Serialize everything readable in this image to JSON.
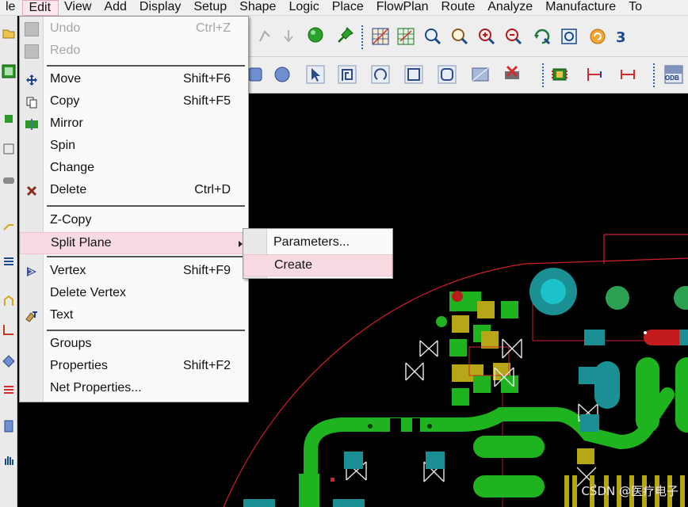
{
  "menubar": {
    "items": [
      "le",
      "Edit",
      "View",
      "Add",
      "Display",
      "Setup",
      "Shape",
      "Logic",
      "Place",
      "FlowPlan",
      "Route",
      "Analyze",
      "Manufacture",
      "To"
    ]
  },
  "edit_menu": {
    "undo": {
      "label": "Undo",
      "shortcut": "Ctrl+Z"
    },
    "redo": {
      "label": "Redo"
    },
    "move": {
      "label": "Move",
      "shortcut": "Shift+F6"
    },
    "copy": {
      "label": "Copy",
      "shortcut": "Shift+F5"
    },
    "mirror": {
      "label": "Mirror"
    },
    "spin": {
      "label": "Spin"
    },
    "change": {
      "label": "Change"
    },
    "delete": {
      "label": "Delete",
      "shortcut": "Ctrl+D"
    },
    "z_copy": {
      "label": "Z-Copy"
    },
    "split_plane": {
      "label": "Split Plane"
    },
    "vertex": {
      "label": "Vertex",
      "shortcut": "Shift+F9"
    },
    "delete_vertex": {
      "label": "Delete Vertex"
    },
    "text": {
      "label": "Text"
    },
    "groups": {
      "label": "Groups"
    },
    "properties": {
      "label": "Properties",
      "shortcut": "Shift+F2"
    },
    "net_properties": {
      "label": "Net Properties..."
    }
  },
  "split_plane_submenu": {
    "parameters": {
      "label": "Parameters..."
    },
    "create": {
      "label": "Create"
    }
  },
  "toolbar": {
    "odb_label": "ODB"
  },
  "watermark": "CSDN @医疗电子",
  "colors": {
    "workspace": "#000000",
    "menu_highlight": "#f8dbe2",
    "pad_green": "#1fb31f",
    "pad_cyan": "#1a8f94",
    "pad_yellow": "#b7a615",
    "outline_red": "#d21f2a"
  }
}
